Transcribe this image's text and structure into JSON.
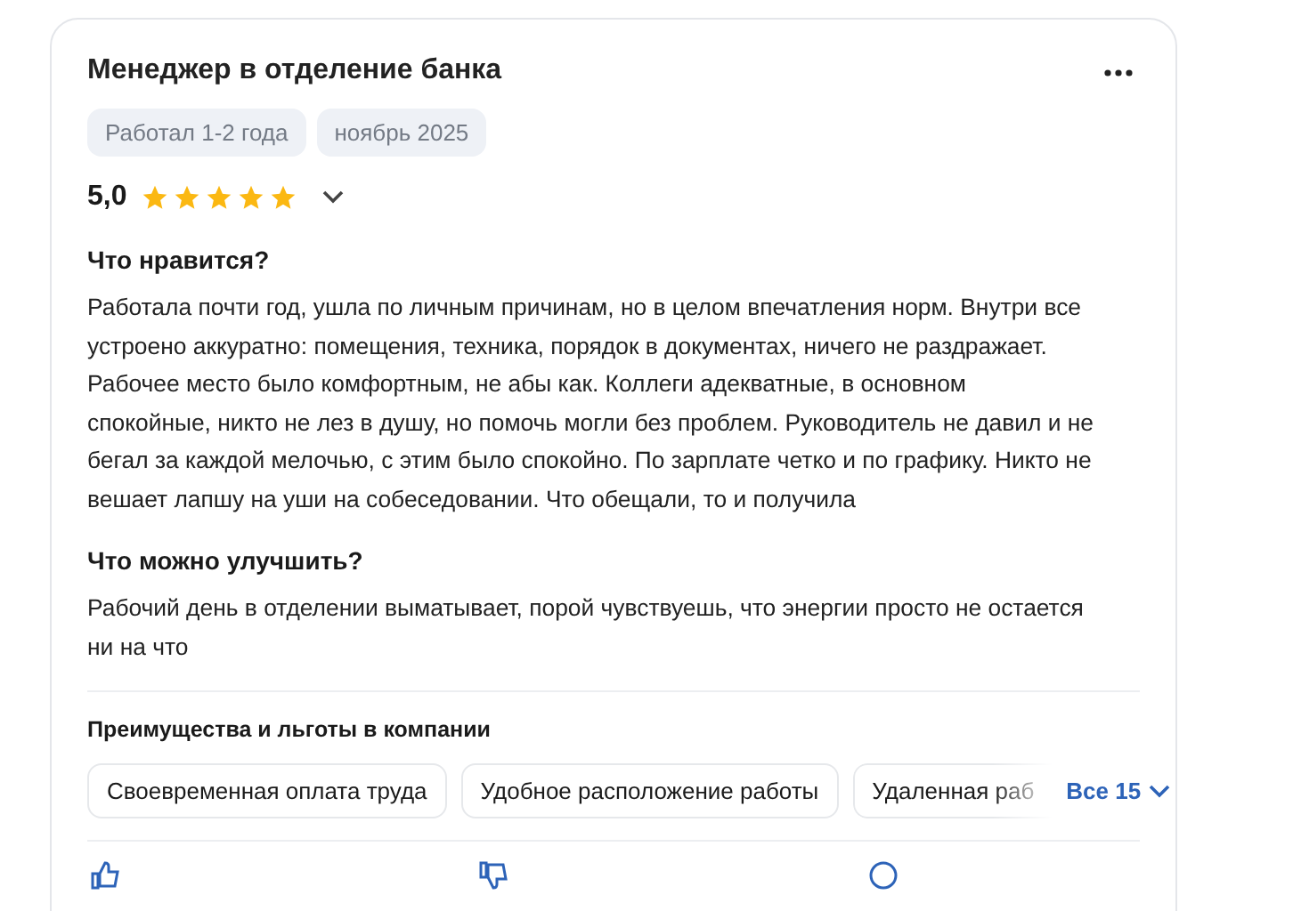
{
  "review": {
    "title": "Менеджер в отделение банка",
    "tags": [
      "Работал 1-2 года",
      "ноябрь 2025"
    ],
    "rating": "5,0",
    "stars": 5,
    "sections": [
      {
        "heading": "Что нравится?",
        "text": "Работала почти год, ушла по личным причинам, но в целом впечатления норм. Внутри все устроено аккуратно: помещения, техника, порядок в документах, ничего не раздражает. Рабочее место было комфортным, не абы как. Коллеги адекватные, в основном спокойные, никто не лез в душу, но помочь могли без проблем. Руководитель не давил и не бегал за каждой мелочью, с этим было спокойно. По зарплате четко и по графику. Никто не вешает лапшу на уши на собеседовании. Что обещали, то и получила"
      },
      {
        "heading": "Что можно улучшить?",
        "text": "Рабочий день в отделении выматывает, порой чувствуешь, что энергии просто не остается ни на что"
      }
    ],
    "benefits": {
      "heading": "Преимущества и льготы в компании",
      "items": [
        "Своевременная оплата труда",
        "Удобное расположение работы",
        "Удаленная раб"
      ],
      "more": "Все 15"
    }
  }
}
